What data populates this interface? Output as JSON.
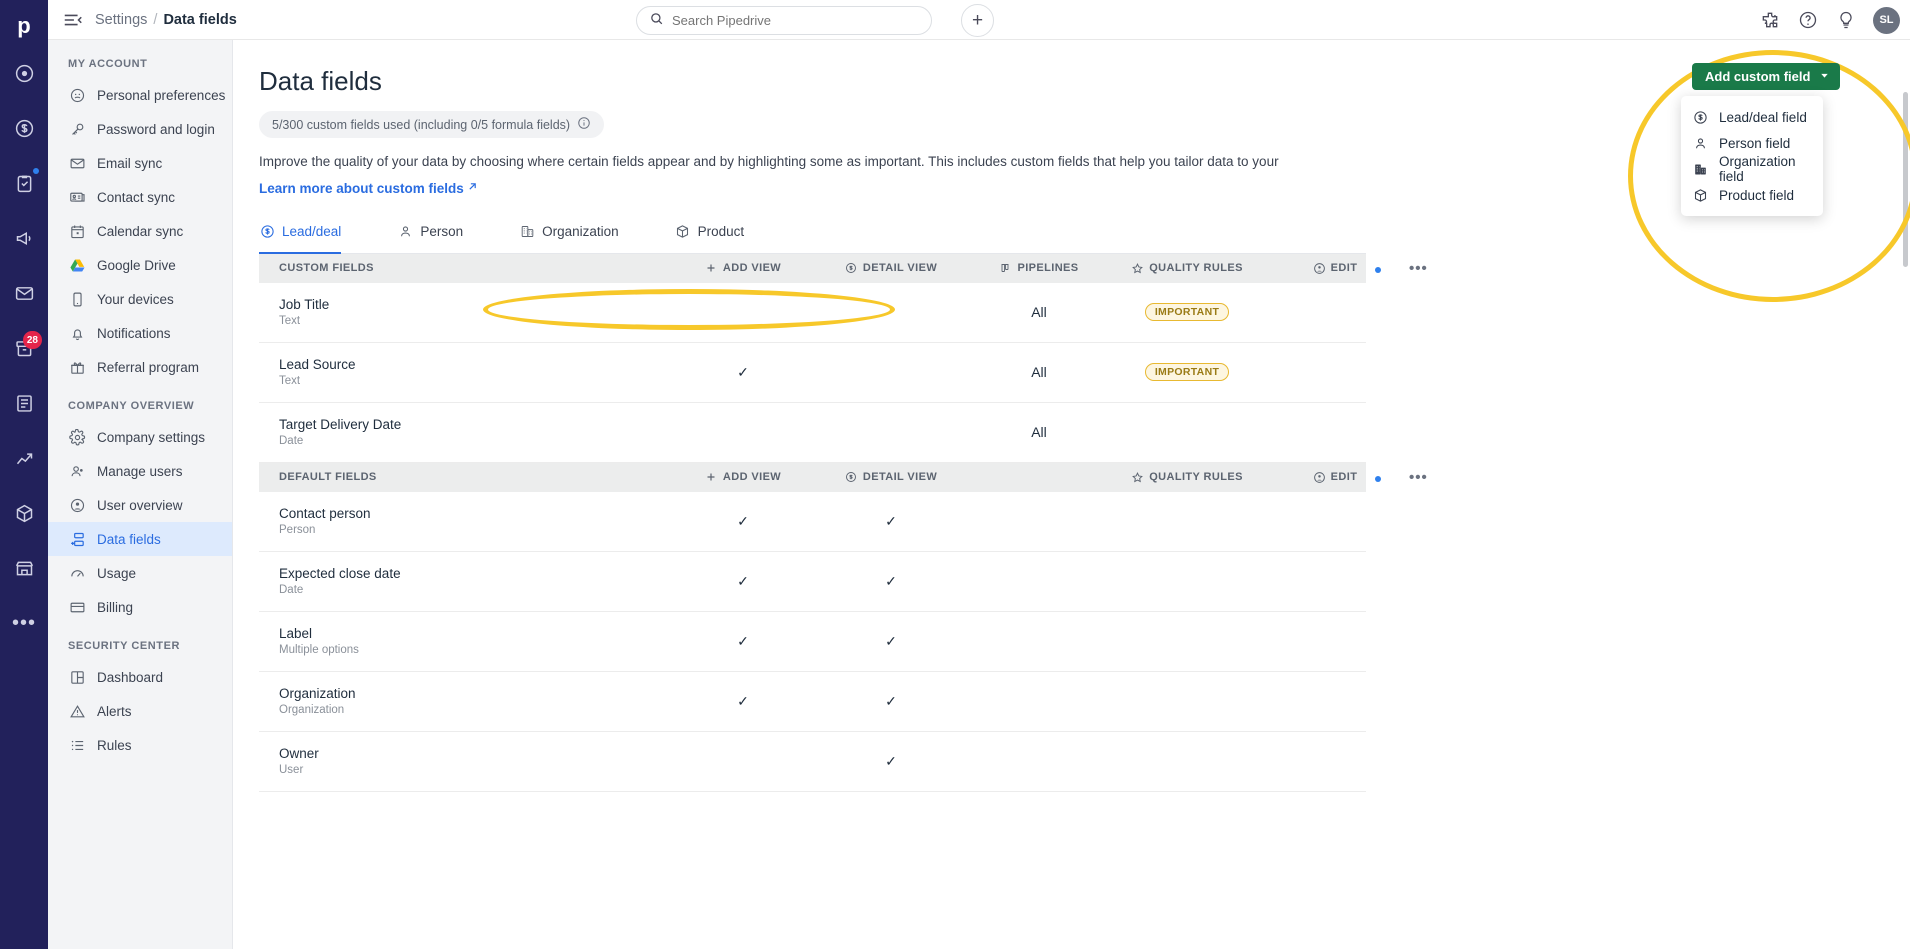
{
  "app": {
    "brand": "pipedrive",
    "logo_letter": "p"
  },
  "topbar": {
    "breadcrumb_root": "Settings",
    "breadcrumb_sep": "/",
    "breadcrumb_current": "Data fields",
    "search_placeholder": "Search Pipedrive",
    "search_value": "",
    "add_label": "+",
    "avatar_initials": "SL"
  },
  "rail": {
    "items": [
      {
        "name": "activities-icon",
        "badge": ""
      },
      {
        "name": "deals-icon",
        "badge": ""
      },
      {
        "name": "leads-icon",
        "badge": ""
      },
      {
        "name": "campaigns-icon",
        "badge": ""
      },
      {
        "name": "mail-icon",
        "badge": ""
      },
      {
        "name": "projects-icon",
        "badge": "28"
      },
      {
        "name": "invoices-icon",
        "badge": ""
      },
      {
        "name": "insights-icon",
        "badge": ""
      },
      {
        "name": "products-icon",
        "badge": ""
      },
      {
        "name": "marketplace-icon",
        "badge": ""
      }
    ],
    "more_label": "•••"
  },
  "sidebar": {
    "sections": [
      {
        "heading": "MY ACCOUNT",
        "items": [
          {
            "label": "Personal preferences",
            "icon": "user-circle-icon",
            "active": false
          },
          {
            "label": "Password and login",
            "icon": "key-icon",
            "active": false
          },
          {
            "label": "Email sync",
            "icon": "envelope-icon",
            "active": false
          },
          {
            "label": "Contact sync",
            "icon": "contact-card-icon",
            "active": false
          },
          {
            "label": "Calendar sync",
            "icon": "calendar-icon",
            "active": false
          },
          {
            "label": "Google Drive",
            "icon": "google-drive-icon",
            "active": false
          },
          {
            "label": "Your devices",
            "icon": "phone-icon",
            "active": false
          },
          {
            "label": "Notifications",
            "icon": "bell-icon",
            "active": false
          },
          {
            "label": "Referral program",
            "icon": "gift-icon",
            "active": false
          }
        ]
      },
      {
        "heading": "COMPANY OVERVIEW",
        "items": [
          {
            "label": "Company settings",
            "icon": "gear-icon",
            "active": false
          },
          {
            "label": "Manage users",
            "icon": "users-icon",
            "active": false
          },
          {
            "label": "User overview",
            "icon": "user-circle-icon",
            "active": false
          },
          {
            "label": "Data fields",
            "icon": "data-fields-icon",
            "active": true
          },
          {
            "label": "Usage",
            "icon": "gauge-icon",
            "active": false
          },
          {
            "label": "Billing",
            "icon": "credit-card-icon",
            "active": false
          }
        ]
      },
      {
        "heading": "SECURITY CENTER",
        "items": [
          {
            "label": "Dashboard",
            "icon": "dashboard-icon",
            "active": false
          },
          {
            "label": "Alerts",
            "icon": "warning-icon",
            "active": false
          },
          {
            "label": "Rules",
            "icon": "list-icon",
            "active": false
          }
        ]
      }
    ]
  },
  "main": {
    "title": "Data fields",
    "usage_chip": "5/300 custom fields used (including 0/5 formula fields)",
    "description": "Improve the quality of your data by choosing where certain fields appear and by highlighting some as important. This includes custom fields that help you tailor data to your",
    "learn_more": "Learn more about custom fields",
    "tabs": [
      {
        "label": "Lead/deal",
        "icon": "deal-dollar-icon",
        "active": true
      },
      {
        "label": "Person",
        "icon": "person-icon",
        "active": false
      },
      {
        "label": "Organization",
        "icon": "organization-icon",
        "active": false
      },
      {
        "label": "Product",
        "icon": "product-box-icon",
        "active": false
      }
    ],
    "add_custom_field": {
      "label": "Add custom field",
      "options": [
        {
          "label": "Lead/deal field",
          "icon": "deal-dollar-icon"
        },
        {
          "label": "Person field",
          "icon": "person-icon"
        },
        {
          "label": "Organization field",
          "icon": "organization-icon"
        },
        {
          "label": "Product field",
          "icon": "product-box-icon"
        }
      ]
    },
    "columns": {
      "add_view": "ADD VIEW",
      "detail_view": "DETAIL VIEW",
      "pipelines": "PIPELINES",
      "quality_rules": "QUALITY RULES",
      "edit": "EDIT",
      "more": "•••"
    },
    "sections": [
      {
        "heading": "CUSTOM FIELDS",
        "show_pipelines": true,
        "rows": [
          {
            "name": "Job Title",
            "type": "Text",
            "add_view": "",
            "detail_view": "",
            "pipelines": "All",
            "quality_rules": "IMPORTANT"
          },
          {
            "name": "Lead Source",
            "type": "Text",
            "add_view": "✓",
            "detail_view": "",
            "pipelines": "All",
            "quality_rules": "IMPORTANT"
          },
          {
            "name": "Target Delivery Date",
            "type": "Date",
            "add_view": "",
            "detail_view": "",
            "pipelines": "All",
            "quality_rules": ""
          }
        ]
      },
      {
        "heading": "DEFAULT FIELDS",
        "show_pipelines": false,
        "rows": [
          {
            "name": "Contact person",
            "type": "Person",
            "add_view": "✓",
            "detail_view": "✓",
            "pipelines": "",
            "quality_rules": ""
          },
          {
            "name": "Expected close date",
            "type": "Date",
            "add_view": "✓",
            "detail_view": "✓",
            "pipelines": "",
            "quality_rules": ""
          },
          {
            "name": "Label",
            "type": "Multiple options",
            "add_view": "✓",
            "detail_view": "✓",
            "pipelines": "",
            "quality_rules": ""
          },
          {
            "name": "Organization",
            "type": "Organization",
            "add_view": "✓",
            "detail_view": "✓",
            "pipelines": "",
            "quality_rules": ""
          },
          {
            "name": "Owner",
            "type": "User",
            "add_view": "",
            "detail_view": "✓",
            "pipelines": "",
            "quality_rules": ""
          }
        ]
      }
    ]
  },
  "colors": {
    "rail_bg": "#22215b",
    "accent_blue": "#2a6ce0",
    "green_button": "#1a7a49",
    "highlight_yellow": "#f7c82a",
    "important_badge": "#9a7b16"
  }
}
